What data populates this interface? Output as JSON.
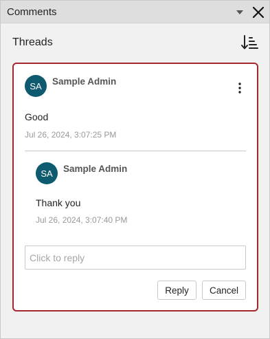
{
  "panel": {
    "title": "Comments",
    "dropdown_icon": "triangle-down-icon",
    "close_icon": "close-icon"
  },
  "threads": {
    "label": "Threads",
    "sort_icon": "sort-descending-icon"
  },
  "thread": {
    "comment": {
      "avatar_initials": "SA",
      "author": "Sample Admin",
      "text": "Good",
      "timestamp": "Jul 26, 2024, 3:07:25 PM",
      "more_icon": "more-vertical-icon"
    },
    "replies": [
      {
        "avatar_initials": "SA",
        "author": "Sample Admin",
        "text": "Thank you",
        "timestamp": "Jul 26, 2024, 3:07:40 PM"
      }
    ],
    "reply_box": {
      "placeholder": "Click to reply",
      "value": ""
    },
    "actions": {
      "reply_label": "Reply",
      "cancel_label": "Cancel"
    }
  },
  "colors": {
    "accent_border": "#a4262c",
    "avatar": "#0e5a6f"
  }
}
